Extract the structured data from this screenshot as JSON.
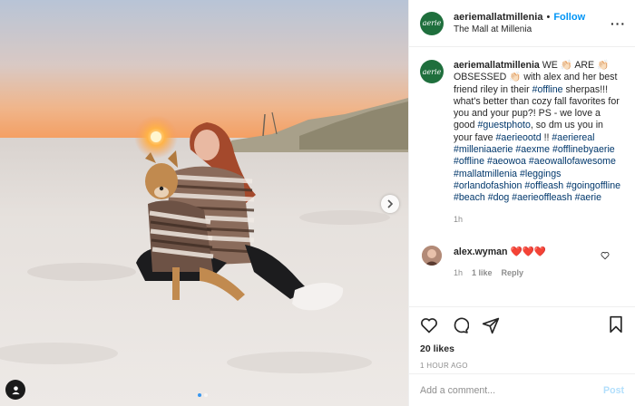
{
  "post": {
    "username": "aeriemallatmillenia",
    "separator": "•",
    "follow_label": "Follow",
    "location": "The Mall at Millenia",
    "avatar_text": "aerie",
    "more_icon": "more-dots-icon"
  },
  "caption": {
    "username": "aeriemallatmillenia",
    "text_1": "WE 👏🏻 ARE 👏🏻 OBSESSED 👏🏻 with alex and her best friend riley in their",
    "tag_offline": "#offline",
    "text_2": "sherpas!!! what's better than cozy fall favorites for you and your pup?! PS - we love a good",
    "tag_guestphoto": "#guestphoto",
    "text_3": ", so dm us you in your fave",
    "tag_aerieootd": "#aerieootd",
    "text_4": "!!",
    "hashtags": [
      "#aeriereal",
      "#milleniaaerie",
      "#aexme",
      "#offlinebyaerie",
      "#offline",
      "#aeowoa",
      "#aeowallofawesome",
      "#mallatmillenia",
      "#leggings",
      "#orlandofashion",
      "#offleash",
      "#goingoffline",
      "#beach",
      "#dog",
      "#aerieoffleash",
      "#aerie"
    ],
    "time": "1h"
  },
  "comment": {
    "username": "alex.wyman",
    "text": "❤️❤️❤️",
    "time": "1h",
    "likes": "1 like",
    "reply": "Reply"
  },
  "actions": {
    "likes": "20 likes",
    "ago": "1 HOUR AGO"
  },
  "composer": {
    "placeholder": "Add a comment...",
    "post_label": "Post"
  },
  "colors": {
    "link": "#00376b",
    "follow": "#0095f6",
    "brand_green": "#1f6f3d"
  },
  "carousel": {
    "count": 2,
    "active_index": 0
  }
}
